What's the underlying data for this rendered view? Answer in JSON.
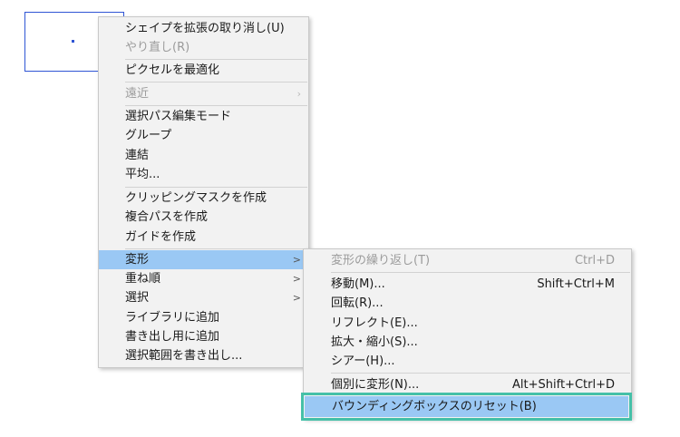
{
  "context_menu": {
    "items": [
      {
        "label": "シェイプを拡張の取り消し(U)"
      },
      {
        "label": "やり直し(R)"
      },
      {
        "label": "ピクセルを最適化"
      },
      {
        "label": "遠近"
      },
      {
        "label": "選択パス編集モード"
      },
      {
        "label": "グループ"
      },
      {
        "label": "連結"
      },
      {
        "label": "平均..."
      },
      {
        "label": "クリッピングマスクを作成"
      },
      {
        "label": "複合パスを作成"
      },
      {
        "label": "ガイドを作成"
      },
      {
        "label": "変形"
      },
      {
        "label": "重ね順"
      },
      {
        "label": "選択"
      },
      {
        "label": "ライブラリに追加"
      },
      {
        "label": "書き出し用に追加"
      },
      {
        "label": "選択範囲を書き出し..."
      }
    ],
    "submenu_arrow": "›",
    "submenu_arrow_dark": ">"
  },
  "transform_submenu": {
    "items": [
      {
        "label": "変形の繰り返し(T)",
        "shortcut": "Ctrl+D"
      },
      {
        "label": "移動(M)...",
        "shortcut": "Shift+Ctrl+M"
      },
      {
        "label": "回転(R)..."
      },
      {
        "label": "リフレクト(E)..."
      },
      {
        "label": "拡大・縮小(S)..."
      },
      {
        "label": "シアー(H)..."
      },
      {
        "label": "個別に変形(N)...",
        "shortcut": "Alt+Shift+Ctrl+D"
      },
      {
        "label": "バウンディングボックスのリセット(B)"
      }
    ]
  },
  "colors": {
    "highlight": "#9ac8f4",
    "focus_outline": "#45c0a8",
    "shape_stroke": "#2f55d4"
  }
}
